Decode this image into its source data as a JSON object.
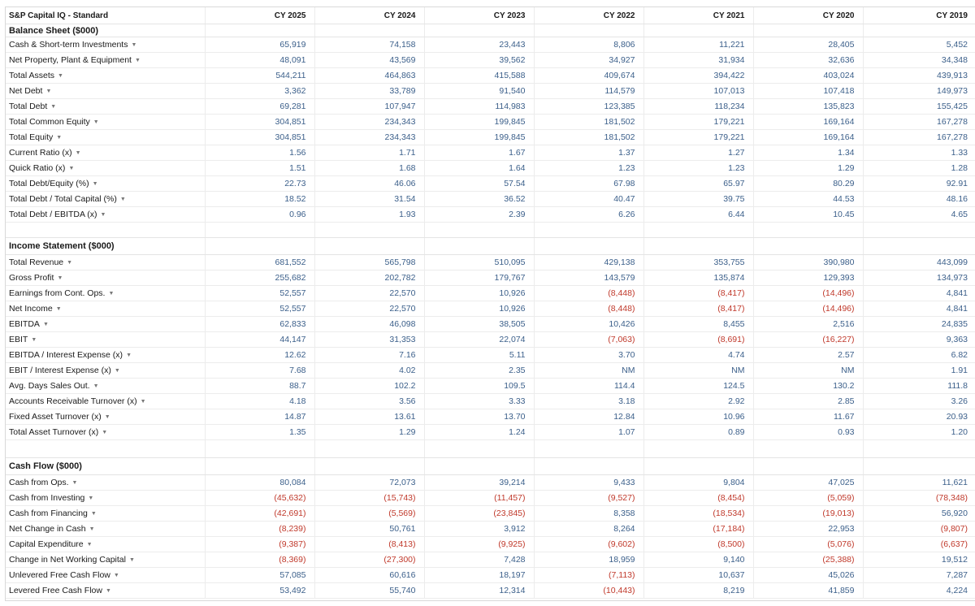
{
  "header": {
    "title": "S&P Capital IQ - Standard",
    "years": [
      "CY 2025",
      "CY 2024",
      "CY 2023",
      "CY 2022",
      "CY 2021",
      "CY 2020",
      "CY 2019"
    ]
  },
  "sections": [
    {
      "title": "Balance Sheet ($000)",
      "rows": [
        {
          "label": "Cash & Short-term Investments",
          "values": [
            "65,919",
            "74,158",
            "23,443",
            "8,806",
            "11,221",
            "28,405",
            "5,452"
          ]
        },
        {
          "label": "Net Property, Plant & Equipment",
          "values": [
            "48,091",
            "43,569",
            "39,562",
            "34,927",
            "31,934",
            "32,636",
            "34,348"
          ]
        },
        {
          "label": "Total Assets",
          "values": [
            "544,211",
            "464,863",
            "415,588",
            "409,674",
            "394,422",
            "403,024",
            "439,913"
          ]
        },
        {
          "label": "Net Debt",
          "values": [
            "3,362",
            "33,789",
            "91,540",
            "114,579",
            "107,013",
            "107,418",
            "149,973"
          ]
        },
        {
          "label": "Total Debt",
          "values": [
            "69,281",
            "107,947",
            "114,983",
            "123,385",
            "118,234",
            "135,823",
            "155,425"
          ]
        },
        {
          "label": "Total Common Equity",
          "values": [
            "304,851",
            "234,343",
            "199,845",
            "181,502",
            "179,221",
            "169,164",
            "167,278"
          ]
        },
        {
          "label": "Total Equity",
          "values": [
            "304,851",
            "234,343",
            "199,845",
            "181,502",
            "179,221",
            "169,164",
            "167,278"
          ]
        },
        {
          "label": "Current Ratio (x)",
          "values": [
            "1.56",
            "1.71",
            "1.67",
            "1.37",
            "1.27",
            "1.34",
            "1.33"
          ]
        },
        {
          "label": "Quick Ratio (x)",
          "values": [
            "1.51",
            "1.68",
            "1.64",
            "1.23",
            "1.23",
            "1.29",
            "1.28"
          ]
        },
        {
          "label": "Total Debt/Equity (%)",
          "values": [
            "22.73",
            "46.06",
            "57.54",
            "67.98",
            "65.97",
            "80.29",
            "92.91"
          ]
        },
        {
          "label": "Total Debt / Total Capital (%)",
          "values": [
            "18.52",
            "31.54",
            "36.52",
            "40.47",
            "39.75",
            "44.53",
            "48.16"
          ]
        },
        {
          "label": "Total Debt / EBITDA (x)",
          "values": [
            "0.96",
            "1.93",
            "2.39",
            "6.26",
            "6.44",
            "10.45",
            "4.65"
          ]
        }
      ]
    },
    {
      "title": "Income Statement ($000)",
      "rows": [
        {
          "label": "Total Revenue",
          "values": [
            "681,552",
            "565,798",
            "510,095",
            "429,138",
            "353,755",
            "390,980",
            "443,099"
          ]
        },
        {
          "label": "Gross Profit",
          "values": [
            "255,682",
            "202,782",
            "179,767",
            "143,579",
            "135,874",
            "129,393",
            "134,973"
          ]
        },
        {
          "label": "Earnings from Cont. Ops.",
          "values": [
            "52,557",
            "22,570",
            "10,926",
            "(8,448)",
            "(8,417)",
            "(14,496)",
            "4,841"
          ]
        },
        {
          "label": "Net Income",
          "values": [
            "52,557",
            "22,570",
            "10,926",
            "(8,448)",
            "(8,417)",
            "(14,496)",
            "4,841"
          ]
        },
        {
          "label": "EBITDA",
          "values": [
            "62,833",
            "46,098",
            "38,505",
            "10,426",
            "8,455",
            "2,516",
            "24,835"
          ]
        },
        {
          "label": "EBIT",
          "values": [
            "44,147",
            "31,353",
            "22,074",
            "(7,063)",
            "(8,691)",
            "(16,227)",
            "9,363"
          ]
        },
        {
          "label": "EBITDA / Interest Expense (x)",
          "values": [
            "12.62",
            "7.16",
            "5.11",
            "3.70",
            "4.74",
            "2.57",
            "6.82"
          ]
        },
        {
          "label": "EBIT / Interest Expense (x)",
          "values": [
            "7.68",
            "4.02",
            "2.35",
            "NM",
            "NM",
            "NM",
            "1.91"
          ]
        },
        {
          "label": "Avg. Days Sales Out.",
          "values": [
            "88.7",
            "102.2",
            "109.5",
            "114.4",
            "124.5",
            "130.2",
            "111.8"
          ]
        },
        {
          "label": "Accounts Receivable Turnover (x)",
          "values": [
            "4.18",
            "3.56",
            "3.33",
            "3.18",
            "2.92",
            "2.85",
            "3.26"
          ]
        },
        {
          "label": "Fixed Asset Turnover (x)",
          "values": [
            "14.87",
            "13.61",
            "13.70",
            "12.84",
            "10.96",
            "11.67",
            "20.93"
          ]
        },
        {
          "label": "Total Asset Turnover (x)",
          "values": [
            "1.35",
            "1.29",
            "1.24",
            "1.07",
            "0.89",
            "0.93",
            "1.20"
          ]
        }
      ]
    },
    {
      "title": "Cash Flow ($000)",
      "rows": [
        {
          "label": "Cash from Ops.",
          "values": [
            "80,084",
            "72,073",
            "39,214",
            "9,433",
            "9,804",
            "47,025",
            "11,621"
          ]
        },
        {
          "label": "Cash from Investing",
          "values": [
            "(45,632)",
            "(15,743)",
            "(11,457)",
            "(9,527)",
            "(8,454)",
            "(5,059)",
            "(78,348)"
          ]
        },
        {
          "label": "Cash from Financing",
          "values": [
            "(42,691)",
            "(5,569)",
            "(23,845)",
            "8,358",
            "(18,534)",
            "(19,013)",
            "56,920"
          ]
        },
        {
          "label": "Net Change in Cash",
          "values": [
            "(8,239)",
            "50,761",
            "3,912",
            "8,264",
            "(17,184)",
            "22,953",
            "(9,807)"
          ]
        },
        {
          "label": "Capital Expenditure",
          "values": [
            "(9,387)",
            "(8,413)",
            "(9,925)",
            "(9,602)",
            "(8,500)",
            "(5,076)",
            "(6,637)"
          ]
        },
        {
          "label": "Change in Net Working Capital",
          "values": [
            "(8,369)",
            "(27,300)",
            "7,428",
            "18,959",
            "9,140",
            "(25,388)",
            "19,512"
          ]
        },
        {
          "label": "Unlevered Free Cash Flow",
          "values": [
            "57,085",
            "60,616",
            "18,197",
            "(7,113)",
            "10,637",
            "45,026",
            "7,287"
          ]
        },
        {
          "label": "Levered Free Cash Flow",
          "values": [
            "53,492",
            "55,740",
            "12,314",
            "(10,443)",
            "8,219",
            "41,859",
            "4,224"
          ]
        }
      ]
    }
  ],
  "colors": {
    "positive": "#3b5f8a",
    "negative": "#c0392b"
  },
  "icons": {
    "row_menu": "caret-down-icon"
  }
}
